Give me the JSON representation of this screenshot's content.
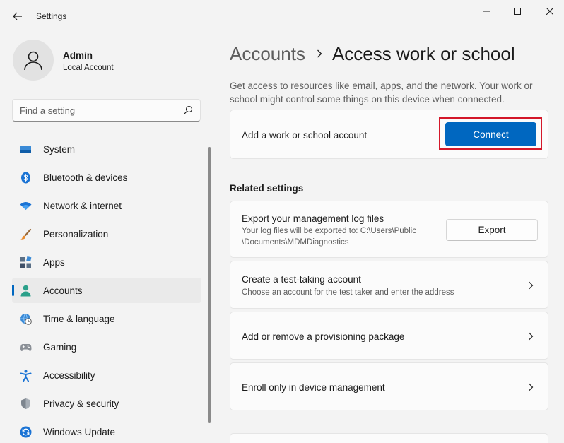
{
  "window": {
    "title": "Settings",
    "controls": [
      "minimize",
      "maximize",
      "close"
    ]
  },
  "profile": {
    "name": "Admin",
    "account_type": "Local Account"
  },
  "search": {
    "placeholder": "Find a setting"
  },
  "sidebar": {
    "items": [
      {
        "label": "System",
        "icon": "system-icon",
        "selected": false
      },
      {
        "label": "Bluetooth & devices",
        "icon": "bluetooth-icon",
        "selected": false
      },
      {
        "label": "Network & internet",
        "icon": "wifi-icon",
        "selected": false
      },
      {
        "label": "Personalization",
        "icon": "paintbrush-icon",
        "selected": false
      },
      {
        "label": "Apps",
        "icon": "apps-icon",
        "selected": false
      },
      {
        "label": "Accounts",
        "icon": "person-icon",
        "selected": true
      },
      {
        "label": "Time & language",
        "icon": "globe-clock-icon",
        "selected": false
      },
      {
        "label": "Gaming",
        "icon": "gamepad-icon",
        "selected": false
      },
      {
        "label": "Accessibility",
        "icon": "accessibility-icon",
        "selected": false
      },
      {
        "label": "Privacy & security",
        "icon": "shield-icon",
        "selected": false
      },
      {
        "label": "Windows Update",
        "icon": "update-icon",
        "selected": false
      }
    ]
  },
  "breadcrumb": {
    "parent": "Accounts",
    "current": "Access work or school"
  },
  "description": "Get access to resources like email, apps, and the network. Your work or school might control some things on this device when connected.",
  "add_account": {
    "label": "Add a work or school account",
    "button": "Connect"
  },
  "related": {
    "heading": "Related settings",
    "export": {
      "title": "Export your management log files",
      "subtitle": "Your log files will be exported to: C:\\Users\\Public\\Documents\\MDMDiagnostics",
      "subtitle_line1": "Your log files will be exported to: C:\\Users\\Public",
      "subtitle_line2": "\\Documents\\MDMDiagnostics",
      "button": "Export"
    },
    "test_account": {
      "title": "Create a test-taking account",
      "subtitle": "Choose an account for the test taker and enter the address"
    },
    "provisioning": {
      "title": "Add or remove a provisioning package"
    },
    "enroll": {
      "title": "Enroll only in device management"
    }
  },
  "colors": {
    "accent": "#0067c0",
    "highlight_border": "#d4182a",
    "background": "#f3f3f3",
    "card": "#fbfbfb"
  }
}
